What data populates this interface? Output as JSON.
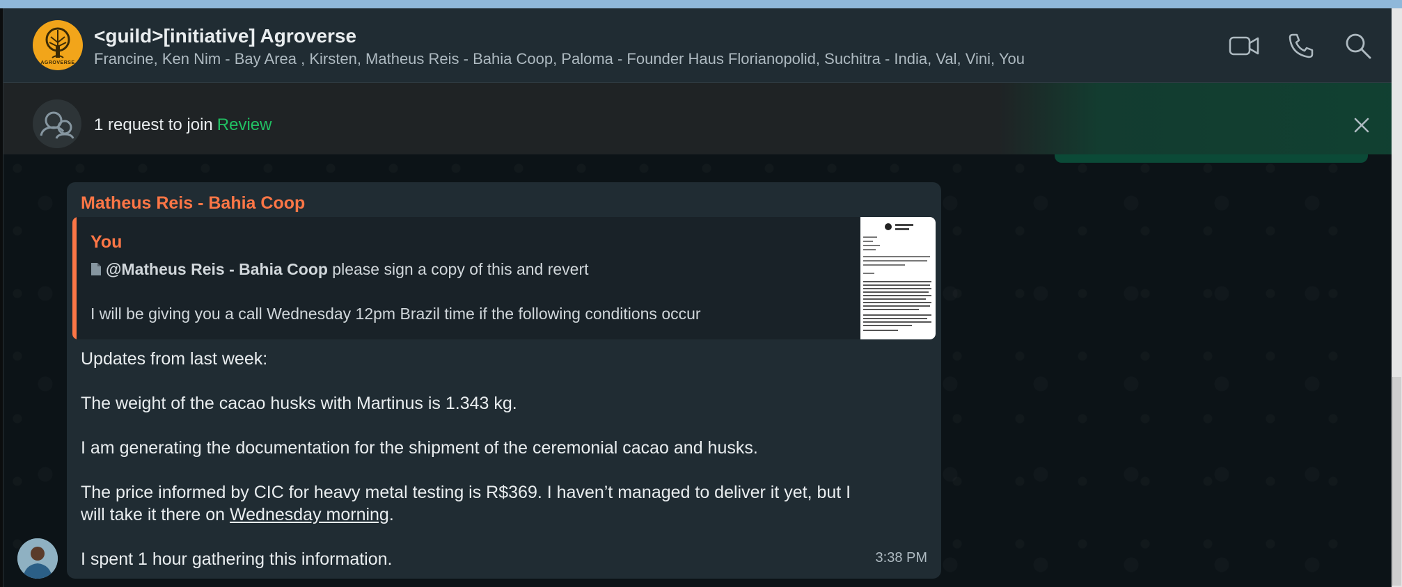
{
  "header": {
    "group_name": "<guild>[initiative] Agroverse",
    "avatar_caption": "AGROVERSE",
    "members": "Francine, Ken Nim - Bay Area , Kirsten, Matheus Reis - Bahia Coop, Paloma - Founder Haus Florianopolid, Suchitra - India, Val, Vini, You",
    "icons": [
      "video-call-icon",
      "voice-call-icon",
      "search-icon"
    ]
  },
  "banner": {
    "text": "1 request to join",
    "action": "Review",
    "icons": [
      "group-request-icon",
      "close-icon"
    ]
  },
  "message": {
    "sender": "Matheus Reis - Bahia Coop",
    "quote": {
      "author": "You",
      "mention": "@Matheus Reis - Bahia Coop",
      "text1": " please sign a copy of this and revert",
      "text2": "I will be giving you a call Wednesday 12pm Brazil time if the following conditions occur"
    },
    "lines": {
      "l1": "Updates from last week:",
      "l2": "The weight of the cacao husks with Martinus is 1.343 kg.",
      "l3": "I am generating the documentation for the shipment of the ceremonial cacao and husks.",
      "l4": "The price informed by CIC for heavy metal testing is R$369. I haven’t managed to deliver it yet, but I",
      "l5a": "will take it there on ",
      "l5link": "Wednesday morning",
      "l5b": ".",
      "l6": "I spent 1 hour gathering this information."
    },
    "time": "3:38 PM"
  },
  "colors": {
    "sender": "#fc7646",
    "review": "#21c063",
    "bubble": "#202c33",
    "header": "#202c33"
  }
}
